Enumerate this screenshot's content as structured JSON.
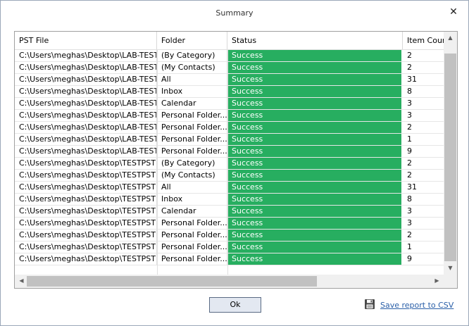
{
  "window": {
    "title": "Summary",
    "close_glyph": "✕"
  },
  "grid": {
    "columns": [
      "PST File",
      "Folder",
      "Status",
      "Item Count"
    ],
    "rows": [
      [
        "C:\\Users\\meghas\\Desktop\\LAB-TEST....",
        "(By Category)",
        "Success",
        "2"
      ],
      [
        "C:\\Users\\meghas\\Desktop\\LAB-TEST....",
        "(My Contacts)",
        "Success",
        "2"
      ],
      [
        "C:\\Users\\meghas\\Desktop\\LAB-TEST....",
        "All",
        "Success",
        "31"
      ],
      [
        "C:\\Users\\meghas\\Desktop\\LAB-TEST....",
        "Inbox",
        "Success",
        "8"
      ],
      [
        "C:\\Users\\meghas\\Desktop\\LAB-TEST....",
        "Calendar",
        "Success",
        "3"
      ],
      [
        "C:\\Users\\meghas\\Desktop\\LAB-TEST....",
        "Personal Folder....",
        "Success",
        "3"
      ],
      [
        "C:\\Users\\meghas\\Desktop\\LAB-TEST....",
        "Personal Folder....",
        "Success",
        "2"
      ],
      [
        "C:\\Users\\meghas\\Desktop\\LAB-TEST....",
        "Personal Folder....",
        "Success",
        "1"
      ],
      [
        "C:\\Users\\meghas\\Desktop\\LAB-TEST....",
        "Personal Folder....",
        "Success",
        "9"
      ],
      [
        "C:\\Users\\meghas\\Desktop\\TESTPST ....",
        "(By Category)",
        "Success",
        "2"
      ],
      [
        "C:\\Users\\meghas\\Desktop\\TESTPST ....",
        "(My Contacts)",
        "Success",
        "2"
      ],
      [
        "C:\\Users\\meghas\\Desktop\\TESTPST ....",
        "All",
        "Success",
        "31"
      ],
      [
        "C:\\Users\\meghas\\Desktop\\TESTPST ....",
        "Inbox",
        "Success",
        "8"
      ],
      [
        "C:\\Users\\meghas\\Desktop\\TESTPST ....",
        "Calendar",
        "Success",
        "3"
      ],
      [
        "C:\\Users\\meghas\\Desktop\\TESTPST ....",
        "Personal Folder....",
        "Success",
        "3"
      ],
      [
        "C:\\Users\\meghas\\Desktop\\TESTPST ....",
        "Personal Folder....",
        "Success",
        "2"
      ],
      [
        "C:\\Users\\meghas\\Desktop\\TESTPST ....",
        "Personal Folder....",
        "Success",
        "1"
      ],
      [
        "C:\\Users\\meghas\\Desktop\\TESTPST ....",
        "Personal Folder....",
        "Success",
        "9"
      ]
    ],
    "status_color": "#27ae60"
  },
  "buttons": {
    "ok": "Ok"
  },
  "save_link": {
    "label": "Save report to CSV",
    "icon": "floppy-disk-icon"
  },
  "colors": {
    "success": "#27ae60",
    "link": "#2a5fa8",
    "button_border": "#5a6b84"
  }
}
